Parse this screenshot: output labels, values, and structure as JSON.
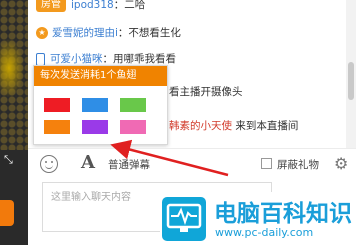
{
  "chat": {
    "lines": [
      {
        "badge": "房管",
        "user": "ipod318",
        "sep": "：",
        "text": "二哈"
      },
      {
        "user": "爱雪妮的理由i",
        "sep": "：",
        "text": "不想看生化"
      },
      {
        "user": "可爱小猫咪",
        "sep": "：",
        "text": "用哪乖我看看"
      },
      {
        "text": "看主播开摄像头"
      },
      {
        "name": "韩素的小天使",
        "text": " 来到本直播间"
      }
    ]
  },
  "color_popup": {
    "title": "每次发送消耗1个鱼翅",
    "colors": [
      "#ee1c24",
      "#2f8ee6",
      "#69c84a",
      "#f5810d",
      "#9a3ae8",
      "#f06ab4"
    ]
  },
  "toolbar": {
    "barrage_label": "普通弹幕",
    "block_gifts_label": "屏蔽礼物"
  },
  "input": {
    "placeholder": "这里输入聊天内容"
  },
  "watermark": {
    "title": "电脑百科知识",
    "url": "www.pc-daily.com"
  }
}
